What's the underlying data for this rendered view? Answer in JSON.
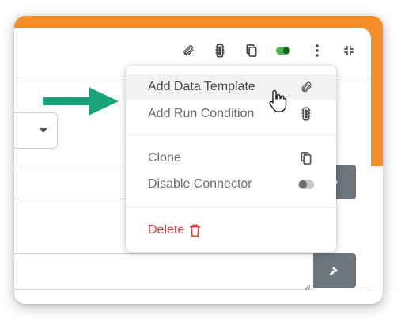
{
  "toolbar": {
    "icons": [
      "paperclip-icon",
      "traffic-light-icon",
      "copy-icon",
      "toggle-on-icon",
      "more-vert-icon",
      "collapse-icon"
    ],
    "accent": "#f58d28",
    "toggle_color": "#4caf50"
  },
  "menu": {
    "add_data_template": "Add Data Template",
    "add_run_condition": "Add Run Condition",
    "clone": "Clone",
    "disable_connector": "Disable Connector",
    "delete": "Delete",
    "delete_color": "#e53935"
  },
  "arrow_color": "#1aa37a"
}
